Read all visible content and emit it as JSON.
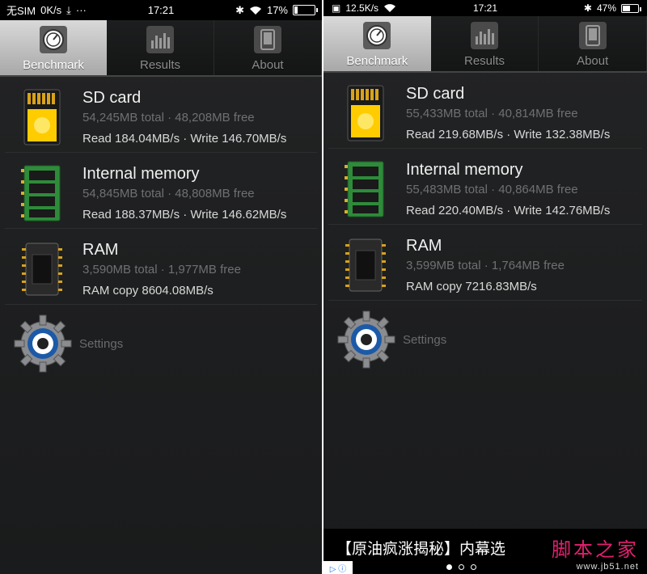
{
  "left": {
    "status": {
      "carrier": "无SIM",
      "speed": "0K/s",
      "time": "17:21",
      "battery": "17%"
    },
    "tabs": [
      {
        "label": "Benchmark"
      },
      {
        "label": "Results"
      },
      {
        "label": "About"
      }
    ],
    "items": [
      {
        "title": "SD card",
        "sub": "54,245MB total · 48,208MB free",
        "result": "Read 184.04MB/s · Write 146.70MB/s"
      },
      {
        "title": "Internal memory",
        "sub": "54,845MB total · 48,808MB free",
        "result": "Read 188.37MB/s · Write 146.62MB/s"
      },
      {
        "title": "RAM",
        "sub": "3,590MB total · 1,977MB free",
        "result": "RAM copy 8604.08MB/s"
      }
    ],
    "settings": "Settings"
  },
  "right": {
    "status": {
      "speed": "12.5K/s",
      "time": "17:21",
      "battery": "47%"
    },
    "tabs": [
      {
        "label": "Benchmark"
      },
      {
        "label": "Results"
      },
      {
        "label": "About"
      }
    ],
    "items": [
      {
        "title": "SD card",
        "sub": "55,433MB total  ·  40,814MB free",
        "result": "Read 219.68MB/s  ·  Write 132.38MB/s"
      },
      {
        "title": "Internal memory",
        "sub": "55,483MB total  ·  40,864MB free",
        "result": "Read 220.40MB/s  ·  Write 142.76MB/s"
      },
      {
        "title": "RAM",
        "sub": "3,599MB total  ·  1,764MB free",
        "result": "RAM copy 7216.83MB/s"
      }
    ],
    "settings": "Settings",
    "ad": {
      "text": "【原油疯涨揭秘】内幕选",
      "watermark_cn": "脚本之家",
      "watermark_url": "www.jb51.net"
    }
  },
  "battery_levels": {
    "left": 0.17,
    "right": 0.47
  },
  "colors": {
    "active_tab": "#c4c4c4",
    "background": "#1e1f20",
    "watermark": "#e0206f"
  }
}
